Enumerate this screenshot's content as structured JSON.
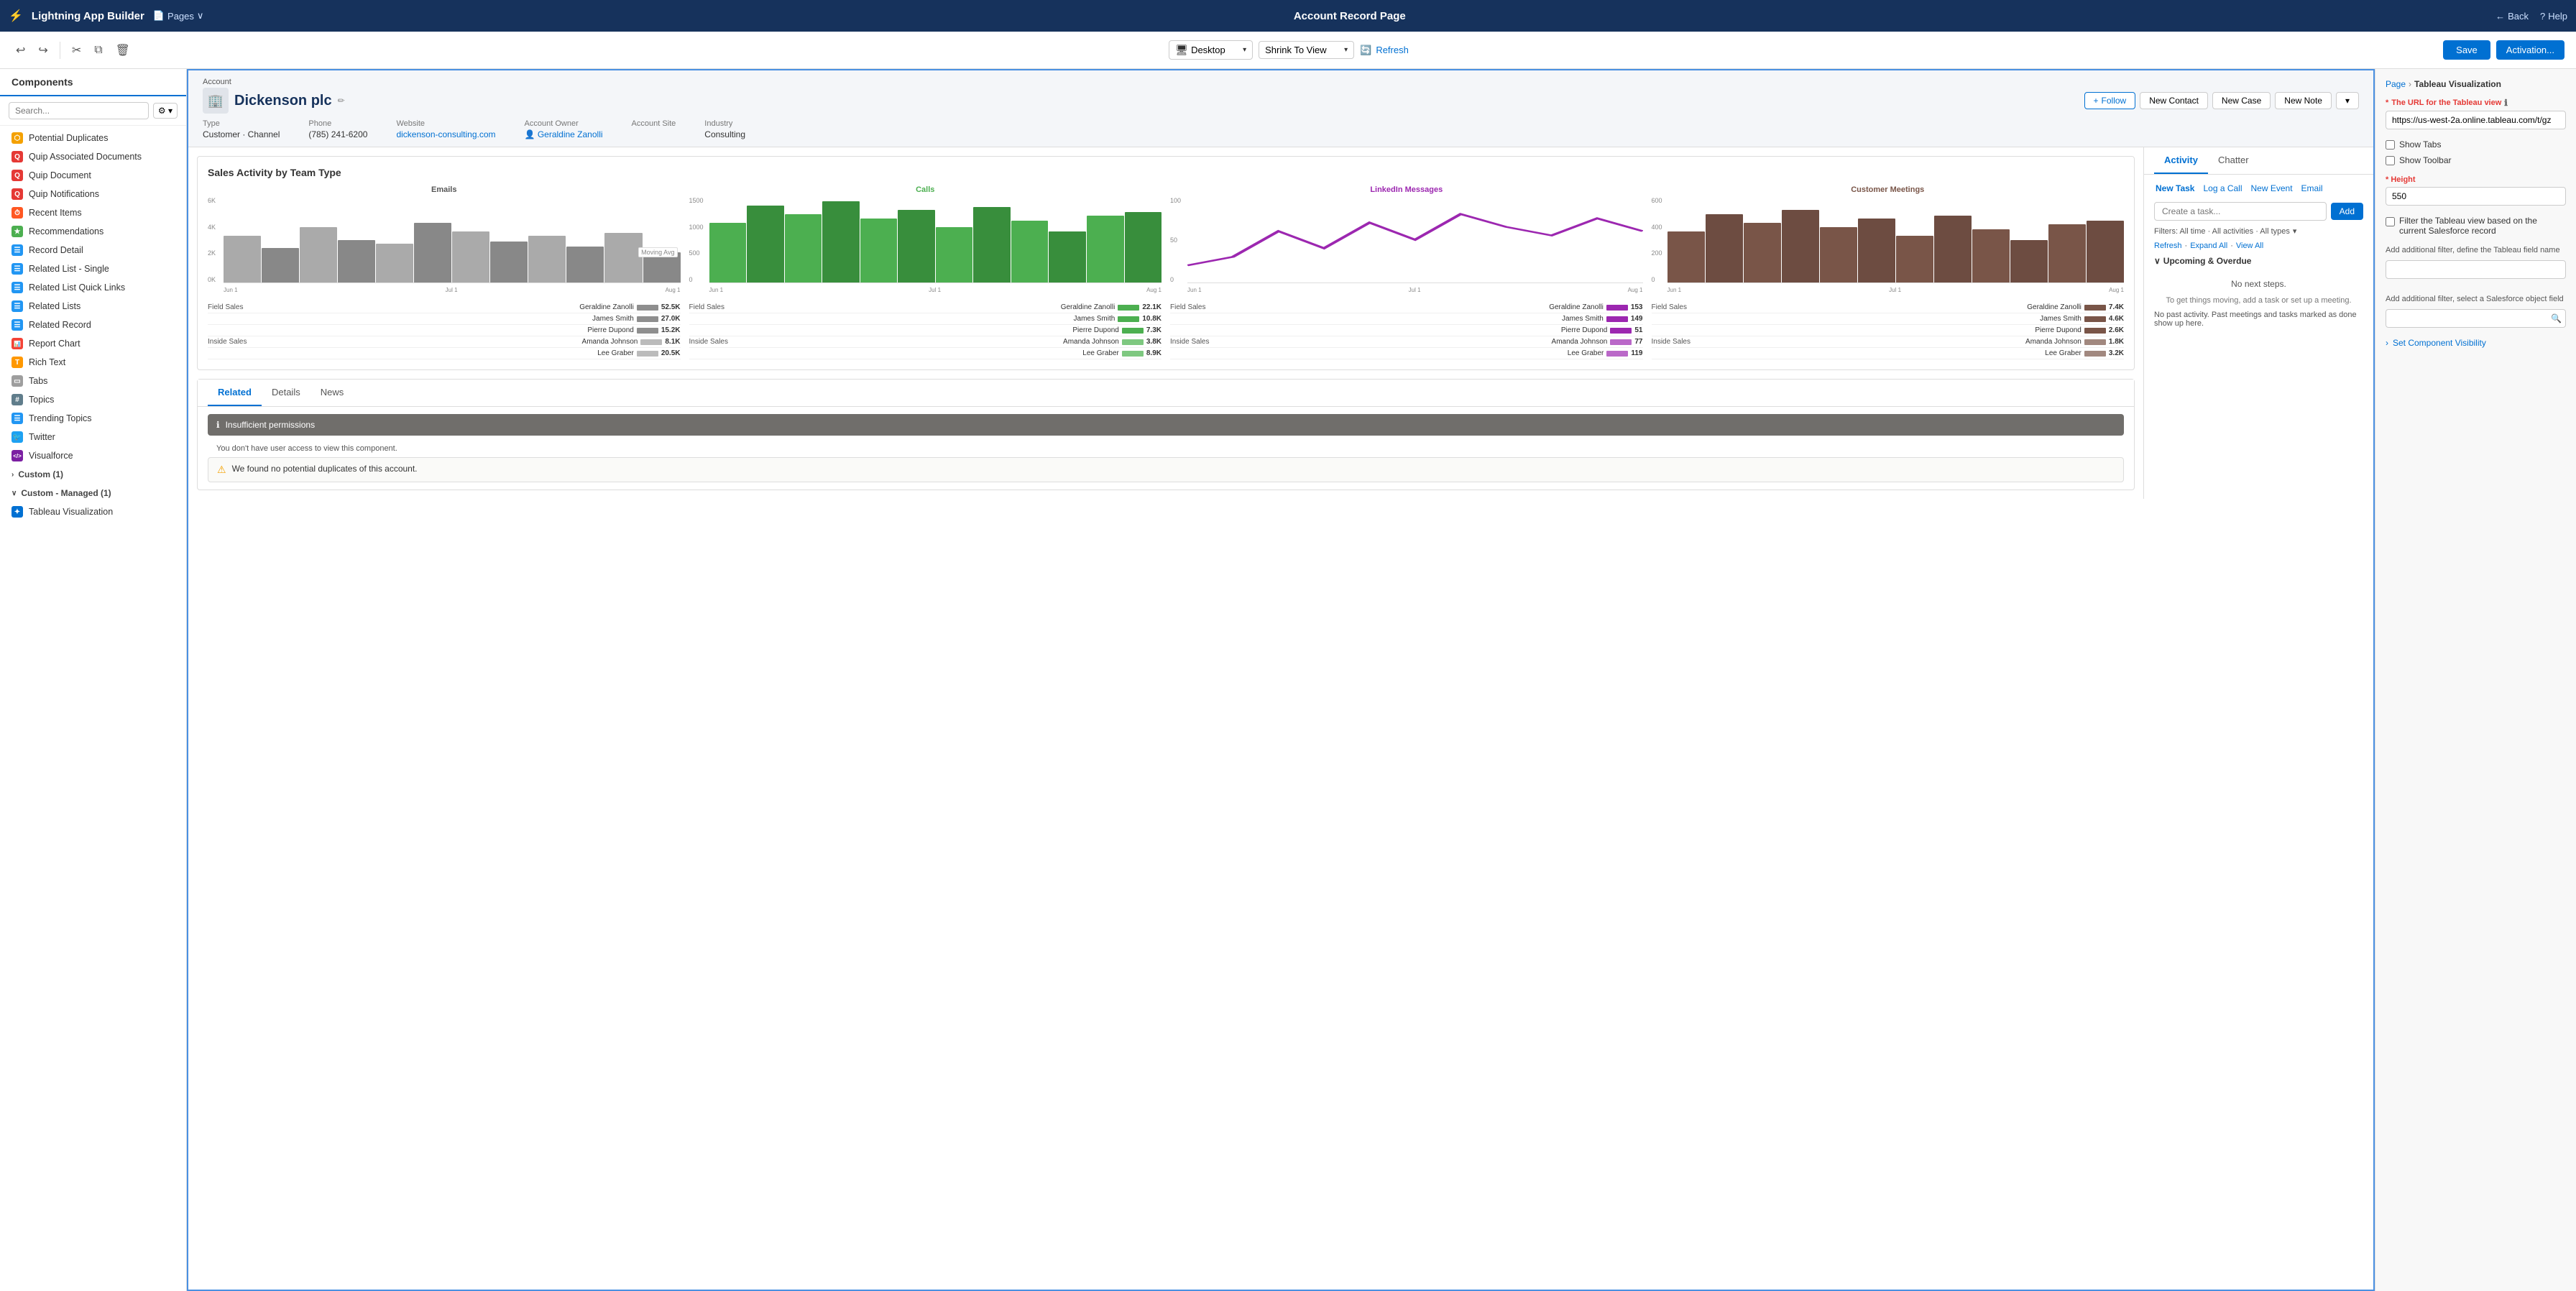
{
  "app": {
    "title": "Account Record Page",
    "nav_app": "Lightning App Builder",
    "nav_pages": "Pages",
    "nav_back": "Back",
    "nav_help": "Help"
  },
  "toolbar": {
    "device": "Desktop",
    "view_mode": "Shrink To View",
    "refresh_label": "Refresh",
    "save_label": "Save",
    "activation_label": "Activation..."
  },
  "components": {
    "header": "Components",
    "search_placeholder": "Search...",
    "items": [
      {
        "label": "Potential Duplicates",
        "color": "#f4a100",
        "icon": "⬡"
      },
      {
        "label": "Quip Associated Documents",
        "color": "#e53935",
        "icon": "Q"
      },
      {
        "label": "Quip Document",
        "color": "#e53935",
        "icon": "Q"
      },
      {
        "label": "Quip Notifications",
        "color": "#e53935",
        "icon": "Q"
      },
      {
        "label": "Recent Items",
        "color": "#ff5722",
        "icon": "⏱"
      },
      {
        "label": "Recommendations",
        "color": "#4caf50",
        "icon": "★"
      },
      {
        "label": "Record Detail",
        "color": "#2196f3",
        "icon": "☰"
      },
      {
        "label": "Related List - Single",
        "color": "#2196f3",
        "icon": "☰"
      },
      {
        "label": "Related List Quick Links",
        "color": "#2196f3",
        "icon": "☰"
      },
      {
        "label": "Related Lists",
        "color": "#2196f3",
        "icon": "☰"
      },
      {
        "label": "Related Record",
        "color": "#2196f3",
        "icon": "☰"
      },
      {
        "label": "Report Chart",
        "color": "#f44336",
        "icon": "📊"
      },
      {
        "label": "Rich Text",
        "color": "#ff9800",
        "icon": "T"
      },
      {
        "label": "Tabs",
        "color": "#9e9e9e",
        "icon": "▭"
      },
      {
        "label": "Topics",
        "color": "#607d8b",
        "icon": "#"
      },
      {
        "label": "Trending Topics",
        "color": "#2196f3",
        "icon": "☰"
      },
      {
        "label": "Twitter",
        "color": "#1da1f2",
        "icon": "🐦"
      },
      {
        "label": "Visualforce",
        "color": "#7b1fa2",
        "icon": "</>"
      }
    ],
    "custom_section": "Custom (1)",
    "custom_managed_section": "Custom - Managed (1)",
    "custom_managed_items": [
      {
        "label": "Tableau Visualization",
        "color": "#0070d2",
        "icon": "✦"
      }
    ]
  },
  "account": {
    "label": "Account",
    "name": "Dickenson plc",
    "type_label": "Type",
    "type_value": "Customer · Channel",
    "phone_label": "Phone",
    "phone_value": "(785) 241-6200",
    "website_label": "Website",
    "website_value": "dickenson-consulting.com",
    "owner_label": "Account Owner",
    "owner_value": "Geraldine Zanolli",
    "site_label": "Account Site",
    "site_value": "",
    "industry_label": "Industry",
    "industry_value": "Consulting",
    "follow_label": "Follow",
    "new_contact_label": "New Contact",
    "new_case_label": "New Case",
    "new_note_label": "New Note"
  },
  "chart": {
    "title": "Sales Activity by Team Type",
    "columns": [
      {
        "label": "Emails",
        "color": "#8e8e8e",
        "y_labels": [
          "6K",
          "4K",
          "2K",
          "0K"
        ],
        "moving_avg": "Moving Avg",
        "rows": [
          {
            "team": "Field Sales",
            "name": "Geraldine Zanolli",
            "value": "52.5K",
            "bar_color": "#8e8e8e"
          },
          {
            "team": "",
            "name": "James Smith",
            "value": "27.0K",
            "bar_color": "#8e8e8e"
          },
          {
            "team": "",
            "name": "Pierre Dupond",
            "value": "15.2K",
            "bar_color": "#8e8e8e"
          },
          {
            "team": "Inside Sales",
            "name": "Amanda Johnson",
            "value": "8.1K",
            "bar_color": "#aaa"
          },
          {
            "team": "",
            "name": "Lee Graber",
            "value": "20.5K",
            "bar_color": "#aaa"
          }
        ]
      },
      {
        "label": "Calls",
        "color": "#4caf50",
        "y_labels": [
          "1500",
          "1000",
          "500",
          "0"
        ],
        "rows": [
          {
            "team": "Field Sales",
            "name": "Geraldine Zanolli",
            "value": "22.1K",
            "bar_color": "#4caf50"
          },
          {
            "team": "",
            "name": "James Smith",
            "value": "10.8K",
            "bar_color": "#4caf50"
          },
          {
            "team": "",
            "name": "Pierre Dupond",
            "value": "7.3K",
            "bar_color": "#4caf50"
          },
          {
            "team": "Inside Sales",
            "name": "Amanda Johnson",
            "value": "3.8K",
            "bar_color": "#7ec880"
          },
          {
            "team": "",
            "name": "Lee Graber",
            "value": "8.9K",
            "bar_color": "#7ec880"
          }
        ]
      },
      {
        "label": "LinkedIn Messages",
        "color": "#9c27b0",
        "y_labels": [
          "100",
          "50",
          "0"
        ],
        "rows": [
          {
            "team": "Field Sales",
            "name": "Geraldine Zanolli",
            "value": "153",
            "bar_color": "#9c27b0"
          },
          {
            "team": "",
            "name": "James Smith",
            "value": "149",
            "bar_color": "#9c27b0"
          },
          {
            "team": "",
            "name": "Pierre Dupond",
            "value": "51",
            "bar_color": "#9c27b0"
          },
          {
            "team": "Inside Sales",
            "name": "Amanda Johnson",
            "value": "77",
            "bar_color": "#ba68c8"
          },
          {
            "team": "",
            "name": "Lee Graber",
            "value": "119",
            "bar_color": "#ba68c8"
          }
        ]
      },
      {
        "label": "Customer Meetings",
        "color": "#795548",
        "y_labels": [
          "600",
          "400",
          "200",
          "0"
        ],
        "rows": [
          {
            "team": "Field Sales",
            "name": "Geraldine Zanolli",
            "value": "7.4K",
            "bar_color": "#795548"
          },
          {
            "team": "",
            "name": "James Smith",
            "value": "4.6K",
            "bar_color": "#795548"
          },
          {
            "team": "",
            "name": "Pierre Dupond",
            "value": "2.6K",
            "bar_color": "#795548"
          },
          {
            "team": "Inside Sales",
            "name": "Amanda Johnson",
            "value": "1.8K",
            "bar_color": "#a1887f"
          },
          {
            "team": "",
            "name": "Lee Graber",
            "value": "3.2K",
            "bar_color": "#a1887f"
          }
        ]
      }
    ],
    "x_labels": [
      "Jun 1",
      "Jul 1",
      "Aug 1"
    ]
  },
  "tabs": {
    "items": [
      "Related",
      "Details",
      "News"
    ],
    "active": "Related"
  },
  "related": {
    "warning_label": "Insufficient permissions",
    "warning_sub": "You don't have user access to view this component.",
    "info_label": "We found no potential duplicates of this account."
  },
  "activity": {
    "tabs": [
      "Activity",
      "Chatter"
    ],
    "active": "Activity",
    "actions": [
      "New Task",
      "Log a Call",
      "New Event",
      "Email"
    ],
    "create_placeholder": "Create a task...",
    "add_label": "Add",
    "filter_text": "Filters: All time · All activities · All types",
    "filter_links": [
      "Refresh",
      "Expand All",
      "View All"
    ],
    "upcoming_label": "Upcoming & Overdue",
    "empty_label": "No next steps.",
    "empty_sub": "To get things moving, add a task or set up a meeting.",
    "past_label": "No past activity. Past meetings and tasks marked as done show up here."
  },
  "right_panel": {
    "breadcrumb_page": "Page",
    "breadcrumb_current": "Tableau Visualization",
    "url_label": "The URL for the Tableau view",
    "url_value": "https://us-west-2a.online.tableau.com/t/gz",
    "show_tabs_label": "Show Tabs",
    "show_toolbar_label": "Show Toolbar",
    "height_label": "Height",
    "height_value": "550",
    "filter_label": "Filter the Tableau view based on the current Salesforce record",
    "add_filter_field_label": "Add additional filter, define the Tableau field name",
    "add_filter_object_label": "Add additional filter, select a Salesforce object field",
    "set_visibility_label": "Set Component Visibility"
  }
}
